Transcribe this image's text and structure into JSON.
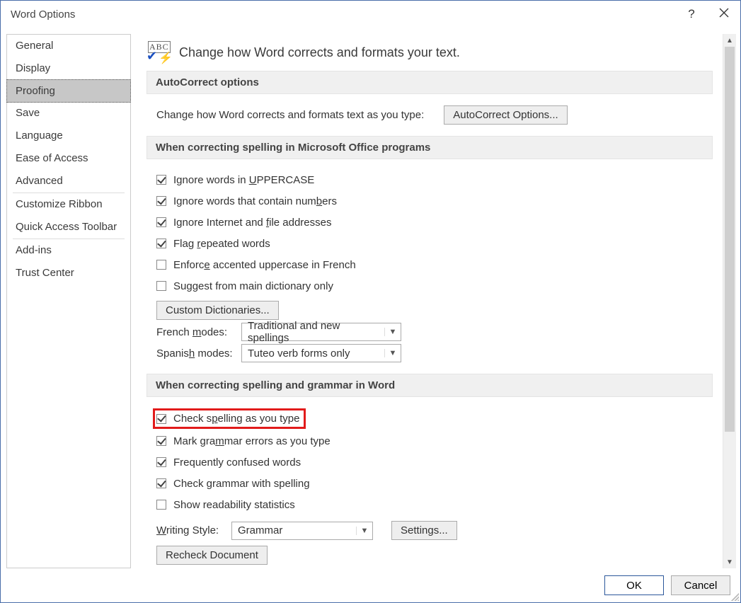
{
  "title": "Word Options",
  "sidebar": {
    "items": [
      {
        "label": "General"
      },
      {
        "label": "Display"
      },
      {
        "label": "Proofing"
      },
      {
        "label": "Save"
      },
      {
        "label": "Language"
      },
      {
        "label": "Ease of Access"
      },
      {
        "label": "Advanced"
      },
      {
        "label": "Customize Ribbon"
      },
      {
        "label": "Quick Access Toolbar"
      },
      {
        "label": "Add-ins"
      },
      {
        "label": "Trust Center"
      }
    ],
    "selected": "Proofing"
  },
  "main": {
    "heading": "Change how Word corrects and formats your text.",
    "abc_text": "ABC",
    "sections": {
      "autocorrect": {
        "title": "AutoCorrect options",
        "desc": "Change how Word corrects and formats text as you type:",
        "button": "AutoCorrect Options..."
      },
      "office_spelling": {
        "title": "When correcting spelling in Microsoft Office programs",
        "checkboxes": [
          {
            "checked": true,
            "pre": "Ignore words in ",
            "u": "U",
            "post": "PPERCASE"
          },
          {
            "checked": true,
            "pre": "Ignore words that contain num",
            "u": "b",
            "post": "ers"
          },
          {
            "checked": true,
            "pre": "Ignore Internet and ",
            "u": "f",
            "post": "ile addresses"
          },
          {
            "checked": true,
            "pre": "Flag ",
            "u": "r",
            "post": "epeated words"
          },
          {
            "checked": false,
            "pre": "Enforc",
            "u": "e",
            "post": " accented uppercase in French"
          },
          {
            "checked": false,
            "pre": "Suggest from main dictionary only",
            "u": "",
            "post": ""
          }
        ],
        "custom_dict_btn": "Custom Dictionaries...",
        "french_label_pre": "French ",
        "french_label_u": "m",
        "french_label_post": "odes:",
        "french_value": "Traditional and new spellings",
        "spanish_label_pre": "Spanis",
        "spanish_label_u": "h",
        "spanish_label_post": " modes:",
        "spanish_value": "Tuteo verb forms only"
      },
      "word_spelling": {
        "title": "When correcting spelling and grammar in Word",
        "checkboxes": [
          {
            "checked": true,
            "pre": "Check s",
            "u": "p",
            "post": "elling as you type"
          },
          {
            "checked": true,
            "pre": "Mark gra",
            "u": "m",
            "post": "mar errors as you type"
          },
          {
            "checked": true,
            "pre": "Frequently confused words",
            "u": "",
            "post": ""
          },
          {
            "checked": true,
            "pre": "Check grammar with spelling",
            "u": "",
            "post": ""
          },
          {
            "checked": false,
            "pre": "Show readability statistics",
            "u": "",
            "post": ""
          }
        ],
        "writing_style_pre": "",
        "writing_style_u": "W",
        "writing_style_post": "riting Style:",
        "writing_style_value": "Grammar",
        "settings_btn": "Settings...",
        "recheck_btn": "Recheck Document"
      }
    }
  },
  "footer": {
    "ok": "OK",
    "cancel": "Cancel"
  }
}
